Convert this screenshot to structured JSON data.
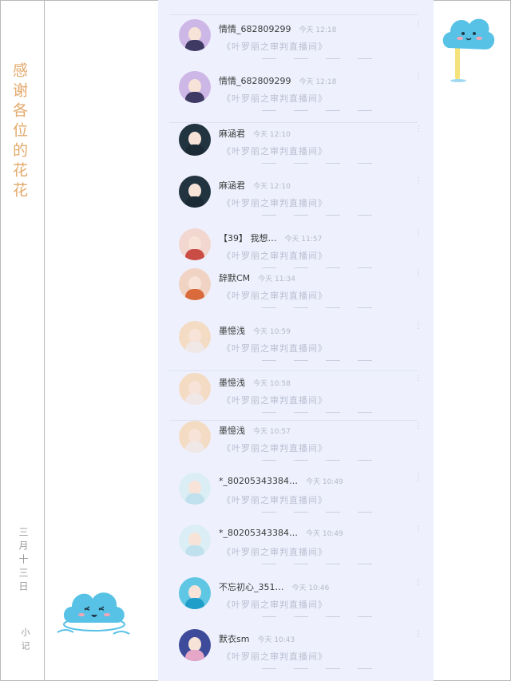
{
  "side": {
    "thanks_text": "感谢各位的花花",
    "date_text": "三月十三日",
    "sign_text": "小记"
  },
  "preview_text": "《叶罗丽之审判直播间》",
  "messages": [
    {
      "name": "情情_682809299",
      "time": "今天 12:18",
      "avatar": {
        "hair": "#cdb7e6",
        "body": "#3f3a63"
      }
    },
    {
      "name": "情情_682809299",
      "time": "今天 12:18",
      "avatar": {
        "hair": "#cdb7e6",
        "body": "#3f3a63"
      }
    },
    {
      "name": "麻涵君",
      "time": "今天 12:10",
      "avatar": {
        "hair": "#22343f",
        "body": "#1b2a35"
      }
    },
    {
      "name": "麻涵君",
      "time": "今天 12:10",
      "avatar": {
        "hair": "#22343f",
        "body": "#1b2a35"
      }
    },
    {
      "name": "【39】 我想…",
      "time": "今天 11:57",
      "avatar": {
        "hair": "#f1d7d0",
        "body": "#c94d44"
      }
    },
    {
      "name": "辞默CM",
      "time": "今天 11:34",
      "avatar": {
        "hair": "#f0d3c2",
        "body": "#d86a3c"
      }
    },
    {
      "name": "墨憶浅",
      "time": "今天 10:59",
      "avatar": {
        "hair": "#f4dcc4",
        "body": "#f0e7e7"
      }
    },
    {
      "name": "墨憶浅",
      "time": "今天 10:58",
      "avatar": {
        "hair": "#f4dcc4",
        "body": "#f0e7e7"
      }
    },
    {
      "name": "墨憶浅",
      "time": "今天 10:57",
      "avatar": {
        "hair": "#f4dcc4",
        "body": "#f0e7e7"
      }
    },
    {
      "name": "*_80205343384…",
      "time": "今天 10:49",
      "avatar": {
        "hair": "#dceef5",
        "body": "#bfe0ec"
      }
    },
    {
      "name": "*_80205343384…",
      "time": "今天 10:49",
      "avatar": {
        "hair": "#dceef5",
        "body": "#bfe0ec"
      }
    },
    {
      "name": "不忘初心_351…",
      "time": "今天 10:46",
      "avatar": {
        "hair": "#5fc6e4",
        "body": "#1f9ec9"
      }
    },
    {
      "name": "默衣sm",
      "time": "今天 10:43",
      "avatar": {
        "hair": "#3d4b9a",
        "body": "#e5a6c8"
      }
    }
  ],
  "colors": {
    "panel_bg": "#eef1fd",
    "accent_orange": "#e3a96a",
    "cloud_blue": "#58c2e6"
  }
}
